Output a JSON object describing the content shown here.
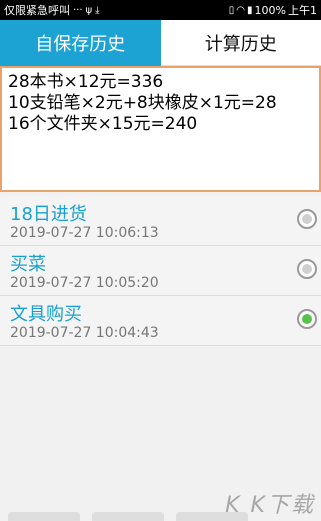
{
  "status_bar": {
    "left_text": "仅限紧急呼叫",
    "battery": "100%",
    "time": "上午1"
  },
  "tabs": [
    {
      "label": "自保存历史",
      "active": true
    },
    {
      "label": "计算历史",
      "active": false
    }
  ],
  "note": {
    "lines": [
      "28本书×12元=336",
      "10支铅笔×2元+8块橡皮×1元=28",
      "16个文件夹×15元=240"
    ]
  },
  "history": [
    {
      "title": "18日进货",
      "time": "2019-07-27 10:06:13",
      "selected": false
    },
    {
      "title": "买菜",
      "time": "2019-07-27 10:05:20",
      "selected": false
    },
    {
      "title": "文具购买",
      "time": "2019-07-27 10:04:43",
      "selected": true
    }
  ],
  "watermark": "K K下载",
  "colors": {
    "accent": "#1da3d3",
    "note_border": "#e8a26a",
    "selected_radio": "#56c24b"
  }
}
